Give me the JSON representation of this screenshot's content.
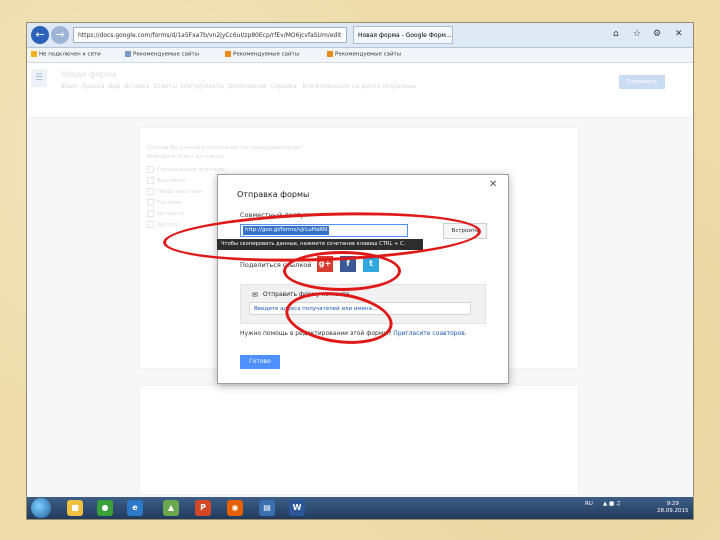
{
  "browser": {
    "url": "https://docs.google.com/forms/d/1a5Fxa7b/vn2jyCc6uI/zp80Ecp/rfEv/MO6jcvfaSUm/edit",
    "tab_active": "Новая форма - Google Форм...",
    "tab_other": "",
    "bookmarks": [
      "Не подключен к сети",
      "Рекомендуемые сайты",
      "Рекомендуемые сайты",
      "Рекомендуемые сайты"
    ]
  },
  "forms_header": {
    "title": "Новая форма",
    "menu": [
      "Файл",
      "Правка",
      "Вид",
      "Вставка",
      "Ответы",
      "Инструменты",
      "Дополнения",
      "Справка"
    ],
    "status": "Все изменения на Диске сохранены",
    "send_button": "Отправить"
  },
  "dialog": {
    "title": "Отправка формы",
    "link_label": "Совместный доступ",
    "link_value": "http://goo.gl/forms/vJrLuHaRN",
    "embed_button": "Встроить",
    "tooltip": "Чтобы скопировать данные, нажмите сочетание клавиш CTRL + C.",
    "share_label": "Поделиться ссылкой",
    "social": {
      "gplus": "g+",
      "facebook": "f",
      "twitter": "t"
    },
    "email_label": "Отправить форму по почте",
    "email_placeholder": "Введите адреса получателей или имена...",
    "note_text": "Нужно помощь в редактировании этой формы?",
    "note_link": "Пригласите соавторов.",
    "done_button": "Готово"
  },
  "background_rows": [
    "Откуда Вы узнали о возможностях гидроцилиндров?",
    "Выберите ответ из списка",
    "Специальные журналы",
    "Выставки",
    "Представители",
    "Реклама",
    "Интернет",
    "Другое"
  ],
  "taskbar": {
    "lang": "RU",
    "time": "9:29",
    "date": "28.09.2015"
  }
}
